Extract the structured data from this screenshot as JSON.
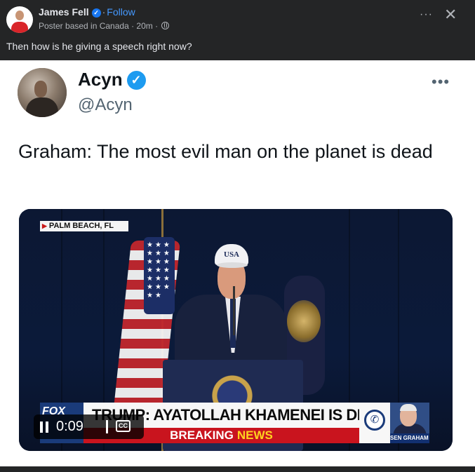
{
  "post": {
    "author": "James Fell",
    "separator": "·",
    "follow_label": "Follow",
    "meta": "Poster based in Canada · 20m ·",
    "more_label": "···",
    "close_label": "✕",
    "text": "Then how is he giving a speech right now?"
  },
  "tweet": {
    "name": "Acyn",
    "handle": "@Acyn",
    "more_label": "•••",
    "text": "Graham: The most evil man on the planet is dead"
  },
  "video": {
    "dateline": "PALM BEACH, FL",
    "cap_text": "USA",
    "network": "FOX",
    "headline": "TRUMP: AYATOLLAH KHAMENEI IS DEAD",
    "breaking": "BREAKING",
    "news": "NEWS",
    "guest_label": "SEN GRAHAM (R-SC)",
    "time": "0:09",
    "cc_label": "CC"
  },
  "colors": {
    "facebook_bg": "#242526",
    "facebook_blue": "#1877f2",
    "twitter_blue": "#1d9bf0",
    "breaking_red": "#c9141e",
    "news_yellow": "#ffd21f",
    "fox_blue": "#1a3b7a"
  },
  "icons": {
    "verified": "verified-badge-icon",
    "globe": "globe-icon",
    "pause": "pause-icon",
    "cc": "closed-captions-icon",
    "phone": "phone-icon"
  }
}
